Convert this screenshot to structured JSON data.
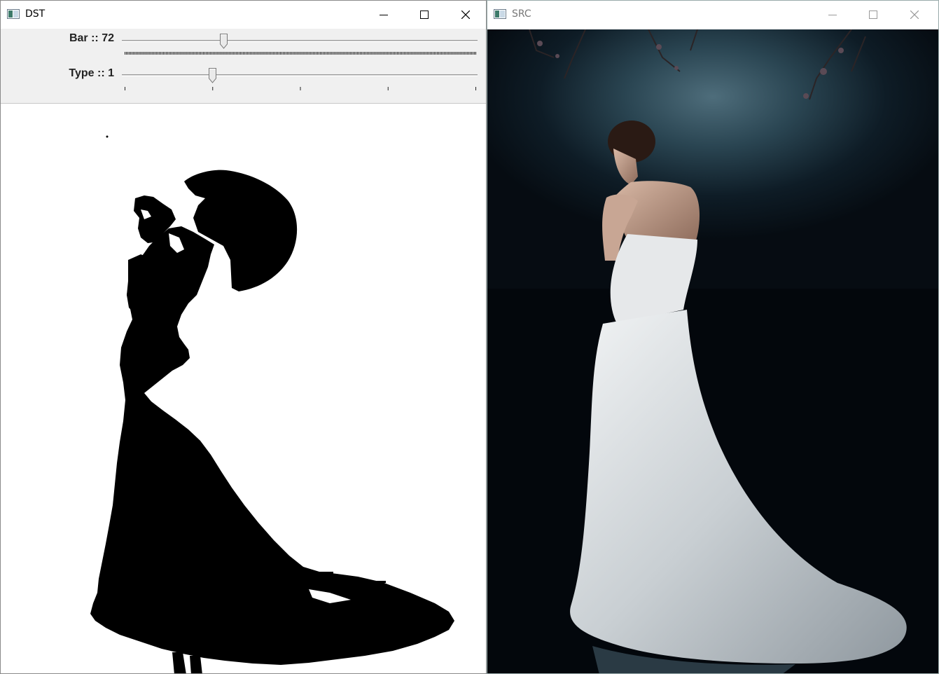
{
  "windows": {
    "dst": {
      "title": "DST",
      "trackbars": [
        {
          "label": "Bar :: 72",
          "value": 72,
          "min": 0,
          "max": 255
        },
        {
          "label": "Type :: 1",
          "value": 1,
          "min": 0,
          "max": 4
        }
      ]
    },
    "src": {
      "title": "SRC"
    }
  },
  "icons": [
    "app-icon",
    "minimize-icon",
    "maximize-icon",
    "close-icon"
  ]
}
